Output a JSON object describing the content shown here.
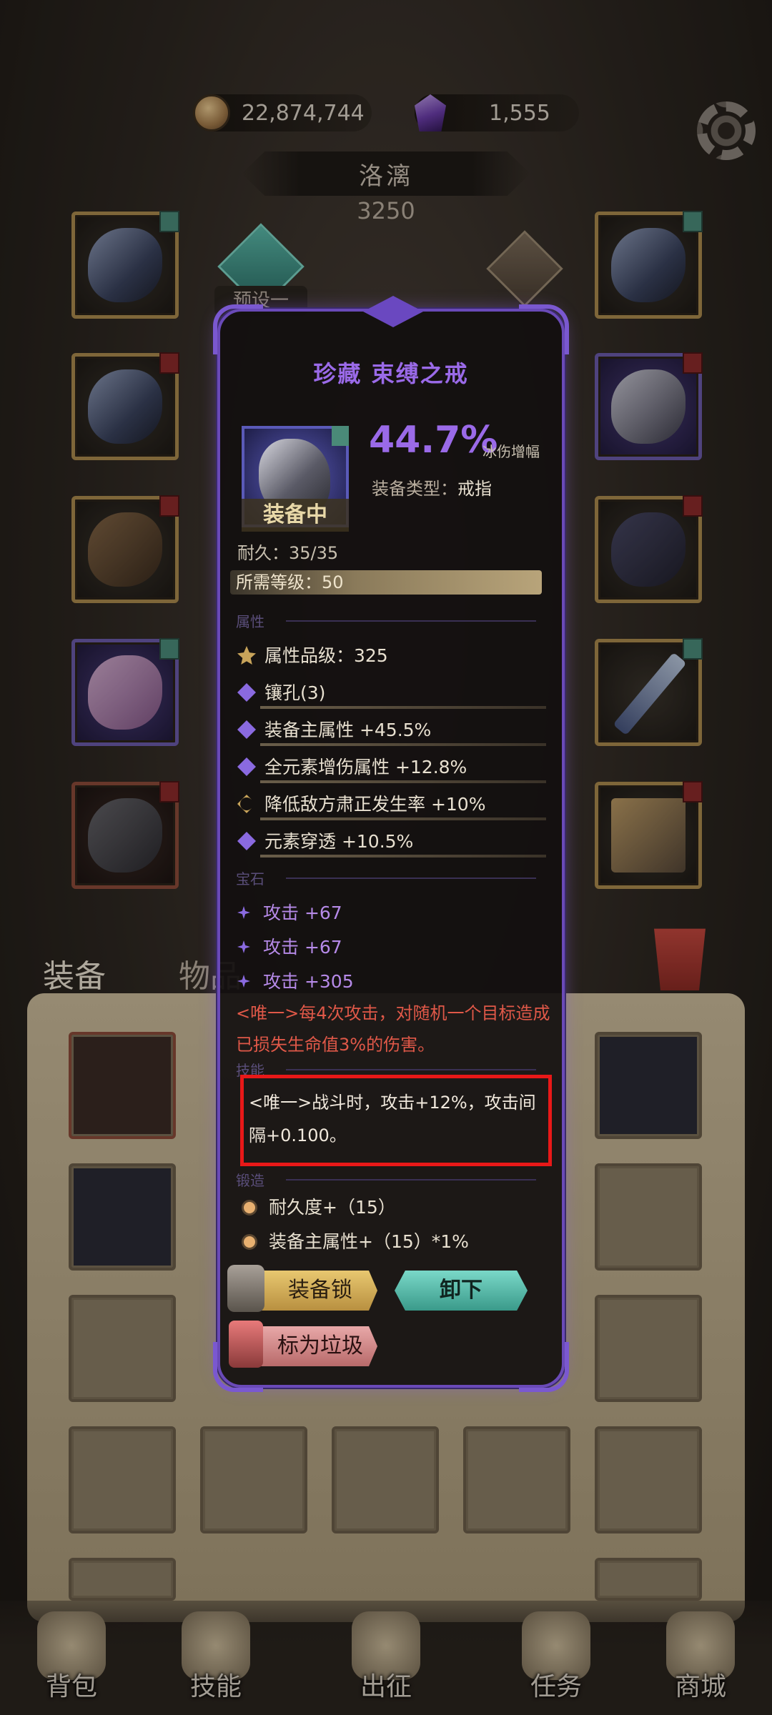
{
  "currency": {
    "coins": "22,874,744",
    "gems": "1,555"
  },
  "hero": {
    "name": "洛漓",
    "power": "3250",
    "preset": "预设一"
  },
  "tabs": {
    "equipment": "装备",
    "items": "物品"
  },
  "popup": {
    "title": "珍藏 束缚之戒",
    "main_percent": "44.7%",
    "main_percent_label": "冰伤增幅",
    "type_label": "装备类型：",
    "type_value": "戒指",
    "status": "装备中",
    "durability": "耐久：35/35",
    "required_level": "所需等级：50",
    "section_attributes": "属性",
    "attributes": [
      "属性品级：325",
      "镶孔(3)",
      "装备主属性 +45.5%",
      "全元素增伤属性 +12.8%",
      "降低敌方肃正发生率 +10%",
      "元素穿透 +10.5%"
    ],
    "section_gems": "宝石",
    "gems": [
      "攻击 +67",
      "攻击 +67",
      "攻击 +305"
    ],
    "unique_effect_1": "<唯一>每4次攻击，对随机一个目标造成已损失生命值3%的伤害。",
    "section_skill": "技能",
    "unique_effect_2": "<唯一>战斗时，攻击+12%，攻击间隔+0.100。",
    "section_refine": "锻造",
    "refines": [
      "耐久度+（15）",
      "装备主属性+（15）*1%"
    ],
    "buttons": {
      "lock": "装备锁",
      "unequip": "卸下",
      "mark_junk": "标为垃圾"
    }
  },
  "nav": [
    "背包",
    "技能",
    "出征",
    "任务",
    "商城"
  ],
  "colors": {
    "accent_purple": "#9a6ae8",
    "unique_red": "#e05848",
    "highlight_box": "#e81818",
    "unequip_teal": "#3a9a8a"
  }
}
